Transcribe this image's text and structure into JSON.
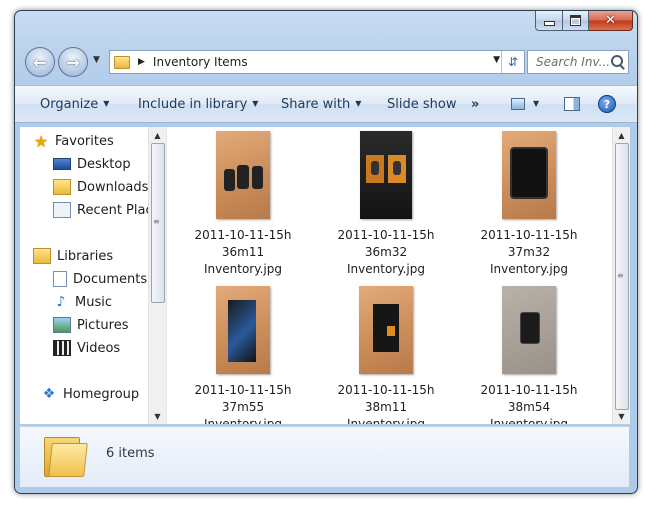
{
  "window": {
    "caption": {
      "minimize": "–",
      "close": "✕"
    }
  },
  "address": {
    "path": "Inventory Items",
    "search_placeholder": "Search Inv..."
  },
  "commands": {
    "organize": "Organize",
    "include": "Include in library",
    "share": "Share with",
    "slideshow": "Slide show",
    "more": "»",
    "help": "?"
  },
  "nav": {
    "favorites": {
      "label": "Favorites",
      "items": [
        {
          "label": "Desktop"
        },
        {
          "label": "Downloads"
        },
        {
          "label": "Recent Places"
        }
      ]
    },
    "libraries": {
      "label": "Libraries",
      "items": [
        {
          "label": "Documents"
        },
        {
          "label": "Music"
        },
        {
          "label": "Pictures"
        },
        {
          "label": "Videos"
        }
      ]
    },
    "homegroup": "Homegroup"
  },
  "files": [
    {
      "line1": "2011-10-11-15h",
      "line2": "36m11",
      "line3": "Inventory.jpg"
    },
    {
      "line1": "2011-10-11-15h",
      "line2": "36m32",
      "line3": "Inventory.jpg"
    },
    {
      "line1": "2011-10-11-15h",
      "line2": "37m32",
      "line3": "Inventory.jpg"
    },
    {
      "line1": "2011-10-11-15h",
      "line2": "37m55",
      "line3": "Inventory.jpg"
    },
    {
      "line1": "2011-10-11-15h",
      "line2": "38m11",
      "line3": "Inventory.jpg"
    },
    {
      "line1": "2011-10-11-15h",
      "line2": "38m54",
      "line3": "Inventory.jpg"
    }
  ],
  "details": {
    "count": "6 items"
  }
}
